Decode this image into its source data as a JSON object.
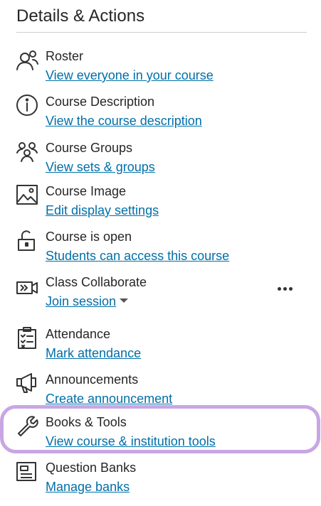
{
  "panel": {
    "title": "Details & Actions"
  },
  "items": [
    {
      "icon": "roster-icon",
      "label": "Roster",
      "link": "View everyone in your course"
    },
    {
      "icon": "info-icon",
      "label": "Course Description",
      "link": "View the course description"
    },
    {
      "icon": "groups-icon",
      "label": "Course Groups",
      "link": "View sets & groups"
    },
    {
      "icon": "image-icon",
      "label": "Course Image",
      "link": "Edit display settings"
    },
    {
      "icon": "unlock-icon",
      "label": "Course is open",
      "link": "Students can access this course"
    },
    {
      "icon": "video-camera-icon",
      "label": "Class Collaborate",
      "link": "Join session",
      "more_icon": "more-options-icon"
    },
    {
      "icon": "clipboard-checklist-icon",
      "label": "Attendance",
      "link": "Mark attendance"
    },
    {
      "icon": "megaphone-icon",
      "label": "Announcements",
      "link": "Create announcement"
    },
    {
      "icon": "wrench-icon",
      "label": "Books & Tools",
      "link": "View course & institution tools",
      "highlighted": true
    },
    {
      "icon": "question-bank-icon",
      "label": "Question Banks",
      "link": "Manage banks"
    }
  ],
  "colors": {
    "link": "#006fa8",
    "text": "#262626",
    "highlight": "#c9a6e3",
    "divider": "#cdcdcd"
  }
}
